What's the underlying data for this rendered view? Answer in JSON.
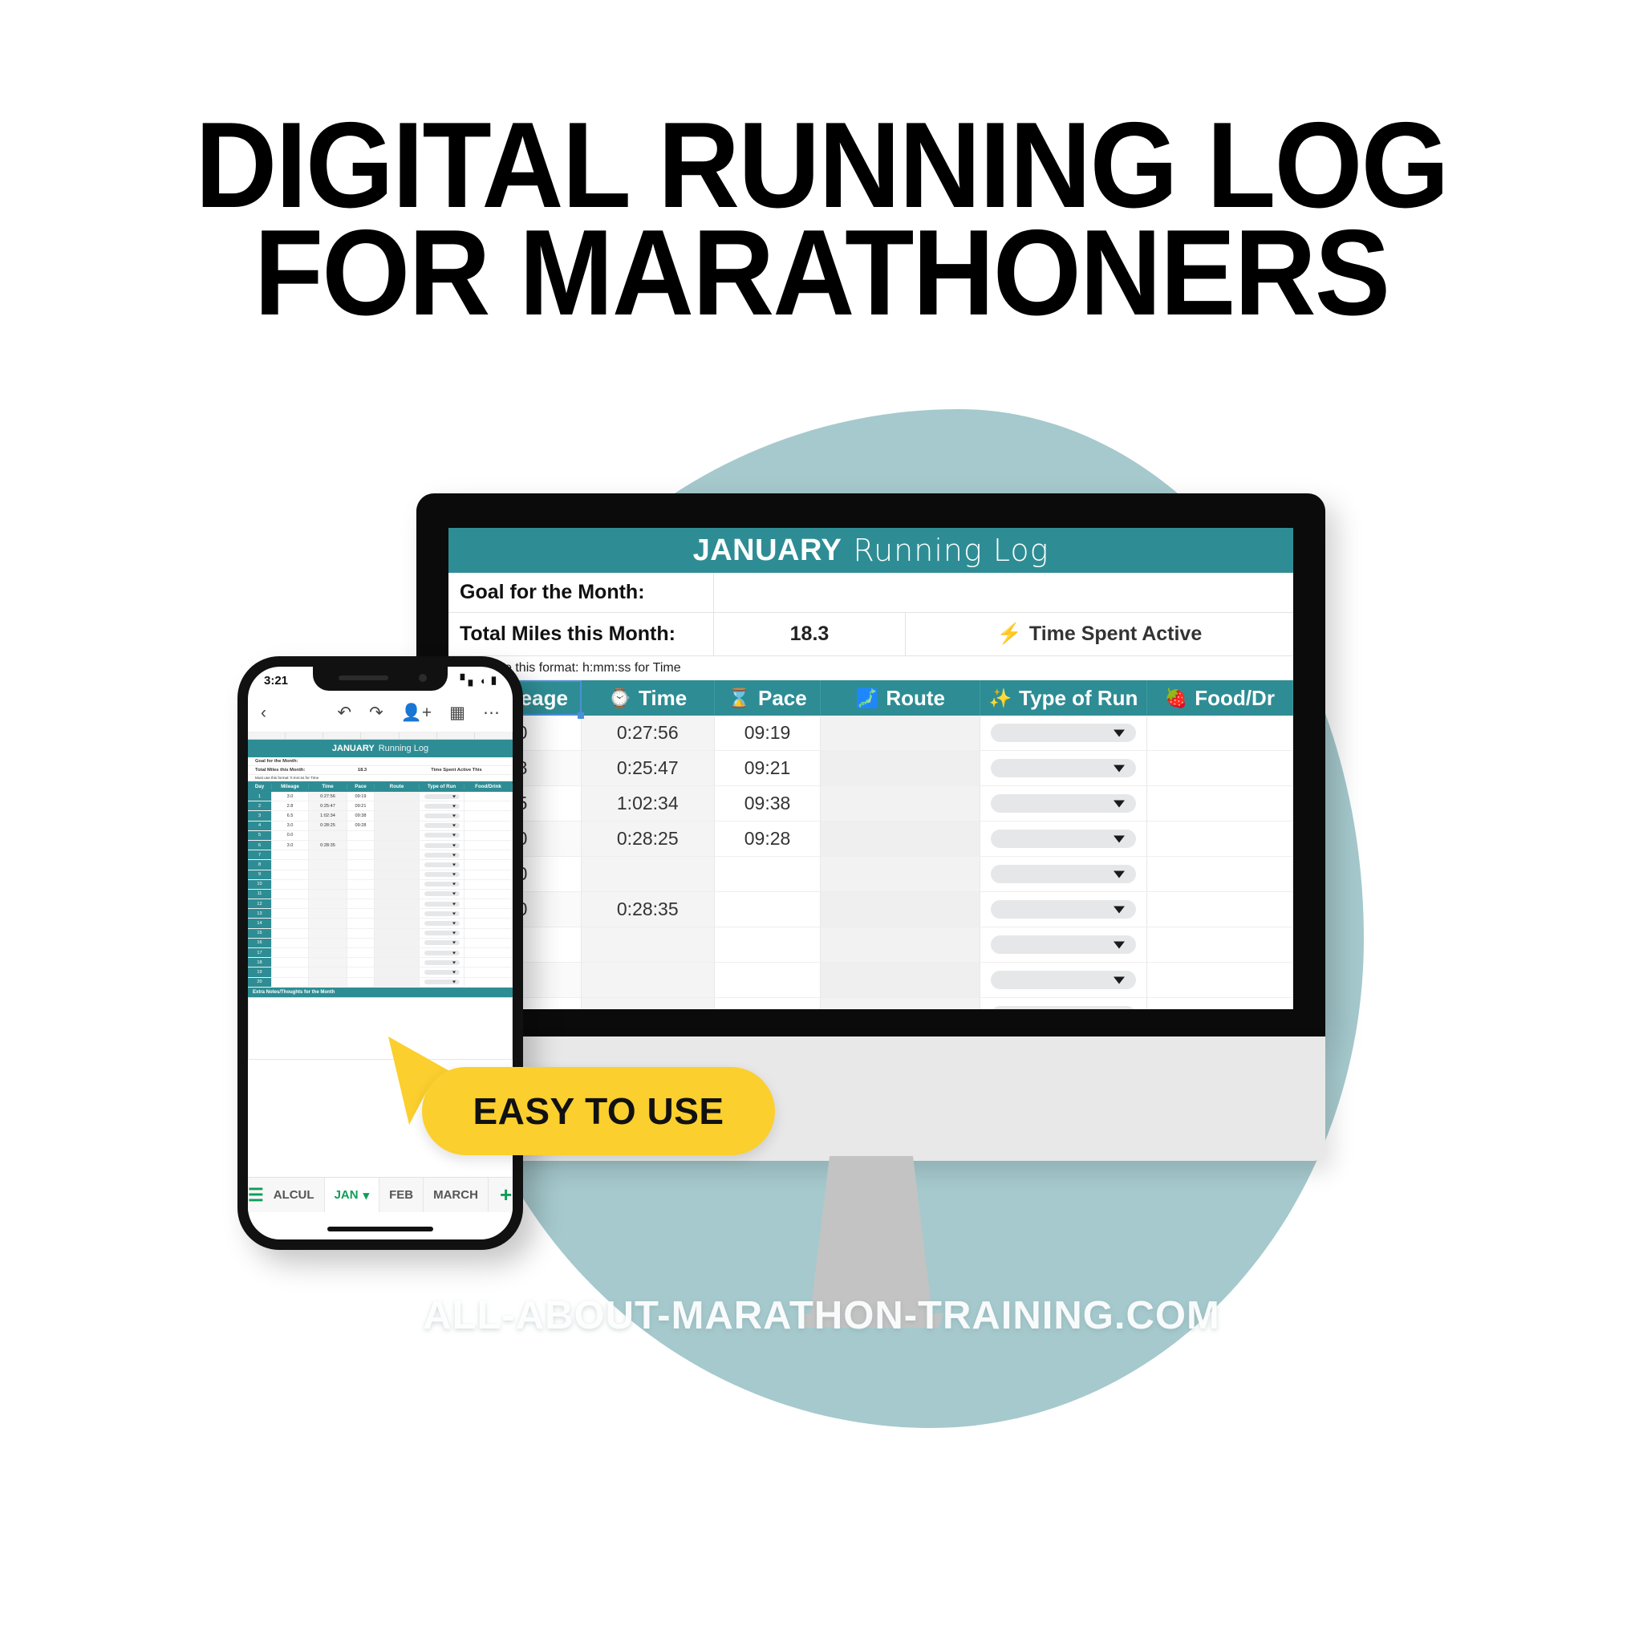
{
  "headline": {
    "line1": "DIGITAL RUNNING LOG",
    "line2": "FOR MARATHONERS"
  },
  "watermark": "ALL-ABOUT-MARATHON-TRAINING.COM",
  "badge": {
    "label": "EASY TO USE"
  },
  "colors": {
    "teal_header": "#2e8d94",
    "blob": "#a5c9cd",
    "badge_yellow": "#fbcf2d",
    "arrow_yellow": "#fbcf2d",
    "active_tab_green": "#0f9d58"
  },
  "desktop": {
    "sheet_title_month": "JANUARY",
    "sheet_title_rest": "Running Log",
    "goal_label": "Goal for the Month:",
    "goal_value": "",
    "total_label": "Total Miles this Month:",
    "total_value": "18.3",
    "time_active_icon": "high-voltage-icon",
    "time_active_label": "Time Spent Active",
    "format_note": "Must use this format: h:mm:ss for Time",
    "headers": [
      {
        "icon": "runner-icon",
        "glyph": "🏃",
        "label": "Mileage"
      },
      {
        "icon": "watch-icon",
        "glyph": "⌚",
        "label": "Time"
      },
      {
        "icon": "hourglass-icon",
        "glyph": "⌛",
        "label": "Pace"
      },
      {
        "icon": "map-icon",
        "glyph": "🗾",
        "label": "Route"
      },
      {
        "icon": "sparkles-icon",
        "glyph": "✨",
        "label": "Type of Run"
      },
      {
        "icon": "strawberry-icon",
        "glyph": "🍓",
        "label": "Food/Dr"
      }
    ],
    "rows": [
      {
        "mileage": "3.0",
        "time": "0:27:56",
        "pace": "09:19",
        "route": "",
        "type": "",
        "food": ""
      },
      {
        "mileage": "2.8",
        "time": "0:25:47",
        "pace": "09:21",
        "route": "",
        "type": "",
        "food": ""
      },
      {
        "mileage": "6.5",
        "time": "1:02:34",
        "pace": "09:38",
        "route": "",
        "type": "",
        "food": ""
      },
      {
        "mileage": "3.0",
        "time": "0:28:25",
        "pace": "09:28",
        "route": "",
        "type": "",
        "food": ""
      },
      {
        "mileage": "0.0",
        "time": "",
        "pace": "",
        "route": "",
        "type": "",
        "food": ""
      },
      {
        "mileage": "3.0",
        "time": "0:28:35",
        "pace": "",
        "route": "",
        "type": "",
        "food": ""
      },
      {
        "mileage": "",
        "time": "",
        "pace": "",
        "route": "",
        "type": "",
        "food": ""
      },
      {
        "mileage": "",
        "time": "",
        "pace": "",
        "route": "",
        "type": "",
        "food": ""
      },
      {
        "mileage": "",
        "time": "",
        "pace": "",
        "route": "",
        "type": "",
        "food": ""
      },
      {
        "mileage": "",
        "time": "",
        "pace": "",
        "route": "",
        "type": "",
        "food": ""
      },
      {
        "mileage": "",
        "time": "",
        "pace": "",
        "route": "",
        "type": "",
        "food": ""
      },
      {
        "mileage": "",
        "time": "",
        "pace": "",
        "route": "",
        "type": "",
        "food": ""
      }
    ]
  },
  "phone": {
    "status_time": "3:21",
    "status_icons": {
      "signal": "▃▆",
      "wifi": "◠",
      "battery": "▮"
    },
    "toolbar_icons": [
      {
        "name": "back-icon",
        "glyph": "‹"
      },
      {
        "name": "undo-icon",
        "glyph": "↶"
      },
      {
        "name": "redo-icon",
        "glyph": "↷"
      },
      {
        "name": "add-person-icon",
        "glyph": "☺⁺"
      },
      {
        "name": "comment-icon",
        "glyph": "▤"
      },
      {
        "name": "more-options-icon",
        "glyph": "⋯"
      }
    ],
    "sheet_title_month": "JANUARY",
    "sheet_title_rest": "Running Log",
    "goal_label": "Goal for the Month:",
    "total_label": "Total Miles this Month:",
    "total_value": "18.3",
    "time_active_label": "Time Spent Active This",
    "format_note": "Must use this format: h:mm:ss for Time",
    "headers": [
      "Day",
      "Mileage",
      "Time",
      "Pace",
      "Route",
      "Type of Run",
      "Food/Drink"
    ],
    "rows": [
      {
        "day": "1",
        "mileage": "3.0",
        "time": "0:27:56",
        "pace": "09:19"
      },
      {
        "day": "2",
        "mileage": "2.8",
        "time": "0:25:47",
        "pace": "09:21"
      },
      {
        "day": "3",
        "mileage": "6.5",
        "time": "1:02:34",
        "pace": "09:38"
      },
      {
        "day": "4",
        "mileage": "3.0",
        "time": "0:28:25",
        "pace": "09:28"
      },
      {
        "day": "5",
        "mileage": "0.0",
        "time": "",
        "pace": ""
      },
      {
        "day": "6",
        "mileage": "3.0",
        "time": "0:28:35",
        "pace": ""
      },
      {
        "day": "7",
        "mileage": "",
        "time": "",
        "pace": ""
      },
      {
        "day": "8",
        "mileage": "",
        "time": "",
        "pace": ""
      },
      {
        "day": "9",
        "mileage": "",
        "time": "",
        "pace": ""
      },
      {
        "day": "10",
        "mileage": "",
        "time": "",
        "pace": ""
      },
      {
        "day": "11",
        "mileage": "",
        "time": "",
        "pace": ""
      },
      {
        "day": "12",
        "mileage": "",
        "time": "",
        "pace": ""
      },
      {
        "day": "13",
        "mileage": "",
        "time": "",
        "pace": ""
      },
      {
        "day": "14",
        "mileage": "",
        "time": "",
        "pace": ""
      },
      {
        "day": "15",
        "mileage": "",
        "time": "",
        "pace": ""
      },
      {
        "day": "16",
        "mileage": "",
        "time": "",
        "pace": ""
      },
      {
        "day": "17",
        "mileage": "",
        "time": "",
        "pace": ""
      },
      {
        "day": "18",
        "mileage": "",
        "time": "",
        "pace": ""
      },
      {
        "day": "19",
        "mileage": "",
        "time": "",
        "pace": ""
      },
      {
        "day": "20",
        "mileage": "",
        "time": "",
        "pace": ""
      }
    ],
    "notes_label": "Extra Notes/Thoughts for the Month",
    "tabs": [
      {
        "label": "ALCUL",
        "active": false
      },
      {
        "label": "JAN",
        "active": true
      },
      {
        "label": "FEB",
        "active": false
      },
      {
        "label": "MARCH",
        "active": false
      }
    ],
    "add_tab_glyph": "+",
    "menu_glyph": "☰"
  }
}
